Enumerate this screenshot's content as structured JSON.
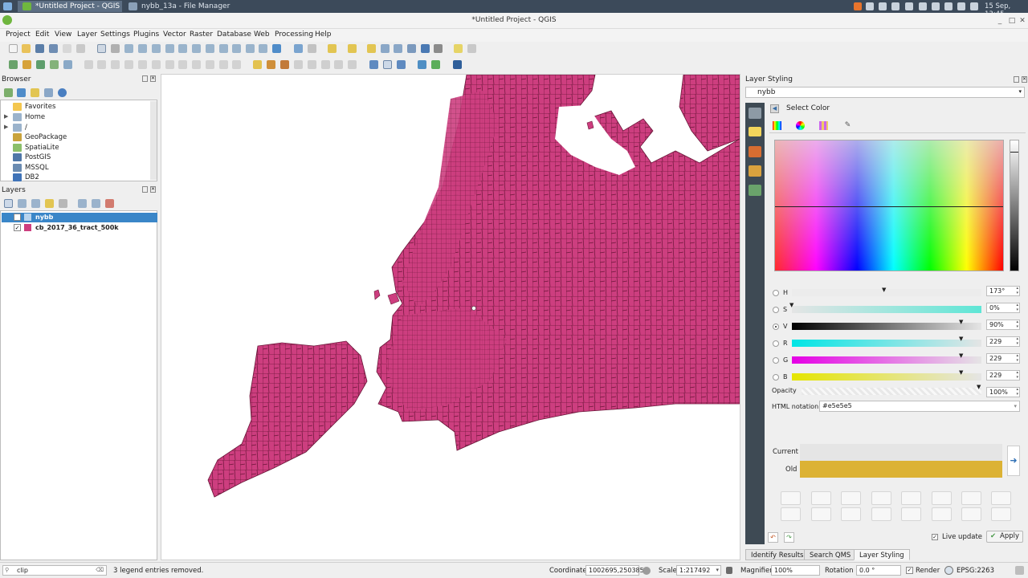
{
  "taskbar": {
    "apps": [
      "*Untitled Project - QGIS",
      "nybb_13a - File Manager"
    ],
    "clock": "15 Sep, 13:45"
  },
  "window": {
    "title": "*Untitled Project - QGIS"
  },
  "menubar": [
    "Project",
    "Edit",
    "View",
    "Layer",
    "Settings",
    "Plugins",
    "Vector",
    "Raster",
    "Database",
    "Web",
    "Processing",
    "Help"
  ],
  "browser": {
    "title": "Browser",
    "items": [
      "Favorites",
      "Home",
      "/",
      "GeoPackage",
      "SpatiaLite",
      "PostGIS",
      "MSSQL",
      "DB2"
    ]
  },
  "layers": {
    "title": "Layers",
    "items": [
      {
        "name": "nybb",
        "checked": false,
        "selected": true,
        "color": "#b8d4ee"
      },
      {
        "name": "cb_2017_36_tract_500k",
        "checked": true,
        "selected": false,
        "color": "#cd3e7f"
      }
    ]
  },
  "map": {
    "fill_color": "#cd3e7f",
    "stroke_color": "#6a1538",
    "background": "#ffffff"
  },
  "styling": {
    "title": "Layer Styling",
    "layer_select": "nybb",
    "header": "Select Color",
    "channels": [
      {
        "label": "H",
        "value": "173°",
        "selected": false
      },
      {
        "label": "S",
        "value": "0%",
        "selected": false
      },
      {
        "label": "V",
        "value": "90%",
        "selected": true
      },
      {
        "label": "R",
        "value": "229",
        "selected": false
      },
      {
        "label": "G",
        "value": "229",
        "selected": false
      },
      {
        "label": "B",
        "value": "229",
        "selected": false
      }
    ],
    "opacity_label": "Opacity",
    "opacity_value": "100%",
    "html_label": "HTML notation",
    "html_value": "#e5e5e5",
    "current_label": "Current",
    "old_label": "Old",
    "current_color": "#e5e5e5",
    "old_color": "#dcb234",
    "live_update_label": "Live update",
    "live_update_checked": true,
    "apply_label": "Apply"
  },
  "bottom_tabs": [
    "Identify Results",
    "Search QMS",
    "Layer Styling"
  ],
  "statusbar": {
    "search_value": "clip",
    "message": "3 legend entries removed.",
    "coordinate_label": "Coordinate",
    "coordinate_value": "1002695,250385",
    "scale_label": "Scale",
    "scale_value": "1:217492",
    "magnifier_label": "Magnifier",
    "magnifier_value": "100%",
    "rotation_label": "Rotation",
    "rotation_value": "0.0 °",
    "render_label": "Render",
    "crs": "EPSG:2263"
  }
}
